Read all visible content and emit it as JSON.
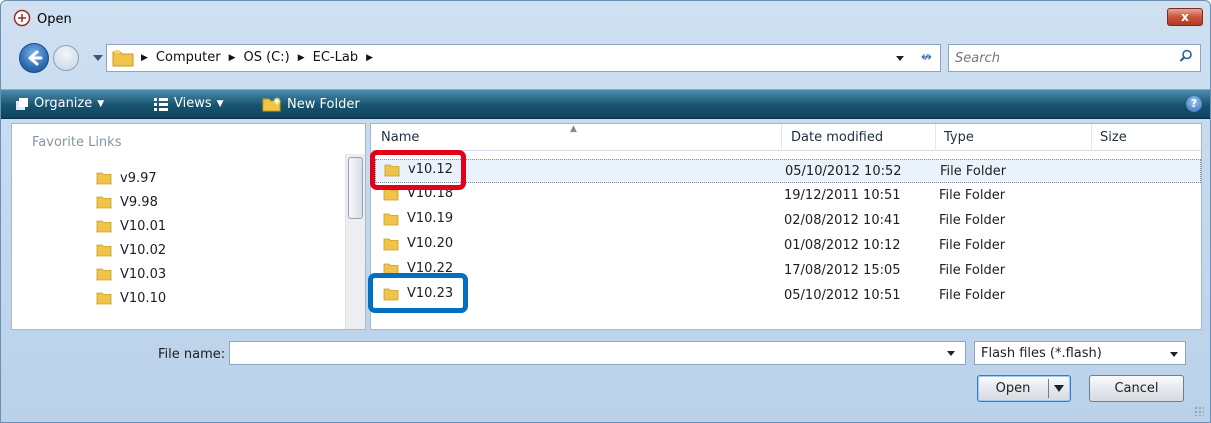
{
  "window": {
    "title": "Open",
    "close_label": "x"
  },
  "nav": {
    "breadcrumbs": [
      "Computer",
      "OS (C:)",
      "EC-Lab"
    ],
    "search_placeholder": "Search"
  },
  "toolbar": {
    "organize": "Organize",
    "views": "Views",
    "new_folder": "New Folder",
    "help": "?"
  },
  "left_pane": {
    "header": "Favorite Links",
    "folders": [
      "v9.97",
      "V9.98",
      "V10.01",
      "V10.02",
      "V10.03",
      "V10.10"
    ]
  },
  "columns": {
    "name": "Name",
    "date": "Date modified",
    "type": "Type",
    "size": "Size"
  },
  "files": [
    {
      "name": "v10.12",
      "date": "05/10/2012 10:52",
      "type": "File Folder",
      "selected": true
    },
    {
      "name": "V10.18",
      "date": "19/12/2011 10:51",
      "type": "File Folder"
    },
    {
      "name": "V10.19",
      "date": "02/08/2012 10:41",
      "type": "File Folder"
    },
    {
      "name": "V10.20",
      "date": "01/08/2012 10:12",
      "type": "File Folder"
    },
    {
      "name": "V10.22",
      "date": "17/08/2012 15:05",
      "type": "File Folder"
    },
    {
      "name": "V10.23",
      "date": "05/10/2012 10:51",
      "type": "File Folder"
    }
  ],
  "annotations": {
    "red_box_target": "v10.12",
    "blue_box_target": "V10.23",
    "red_color": "#e4001b",
    "blue_color": "#0071c0"
  },
  "bottom": {
    "file_name_label": "File name:",
    "file_name_value": "",
    "filter_value": "Flash files (*.flash)",
    "open_label": "Open",
    "cancel_label": "Cancel"
  }
}
